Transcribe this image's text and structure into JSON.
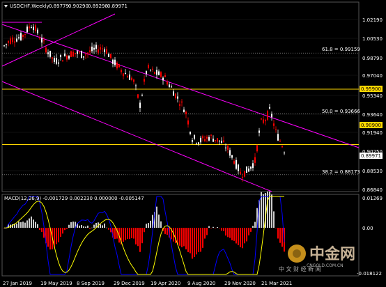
{
  "header": {
    "symbol_label": "USDCHF,Weekly",
    "open": "0.89779",
    "high": "0.90290",
    "low": "0.89298",
    "close": "0.89971"
  },
  "price_axis": {
    "ticks": [
      "1.02190",
      "1.00530",
      "0.98790",
      "0.97040",
      "0.95340",
      "0.93640",
      "0.91940",
      "0.90250",
      "0.88530",
      "0.86840"
    ],
    "hidden_tick": "0.90250",
    "highlight_labels": [
      {
        "text": "0.95900",
        "color": "#ffd700"
      },
      {
        "text": "0.90900",
        "color": "#ffd700"
      },
      {
        "text": "0.89971",
        "color": "#ffffff"
      }
    ]
  },
  "fib_levels": [
    {
      "label": "61.8 = 0.99159",
      "price": 0.99159
    },
    {
      "label": "50.0 = 0.93666",
      "price": 0.93666
    },
    {
      "label": "38.2 = 0.88173",
      "price": 0.88173
    }
  ],
  "horizontal_lines": [
    {
      "price": 0.959,
      "color": "#ffd700"
    },
    {
      "price": 0.909,
      "color": "#ffd700"
    }
  ],
  "macd": {
    "label": "MACD(12,26,9) -0.001729 0.002230 0.000000 -0.005147",
    "axis_ticks": [
      "0.01269",
      "0.00",
      "-0.018122"
    ]
  },
  "time_axis": {
    "labels": [
      "27 Jan 2019",
      "19 May 2019",
      "8 Sep 2019",
      "29 Dec 2019",
      "19 Apr 2020",
      "9 Aug 2020",
      "29 Nov 2020",
      "21 Mar 2021"
    ]
  },
  "watermark": {
    "brand": "中金网",
    "tagline": "中 文 财 经 新 闻",
    "domain": "CNGOLD.COM.CN"
  },
  "colors": {
    "bull": "#ffffff",
    "bear": "#ff0000",
    "channel": "#ff00ff",
    "level": "#ffd700",
    "macd_line": "#0000ff",
    "signal_line": "#ffff00"
  }
}
